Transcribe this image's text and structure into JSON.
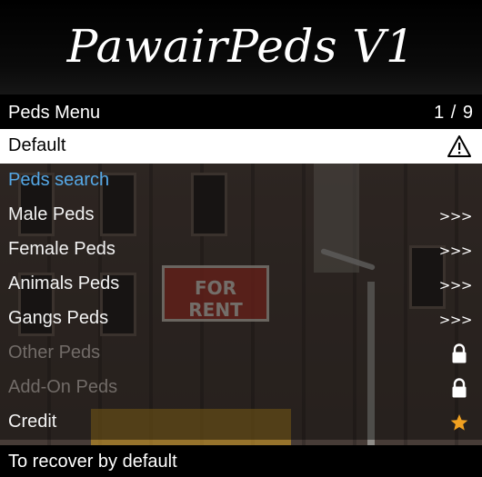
{
  "menu": {
    "title": "PawairPeds V1",
    "subtitle": "Peds Menu",
    "counter": "1 / 9",
    "items": [
      {
        "label": "Default",
        "state": "selected",
        "indicator": "warning-icon"
      },
      {
        "label": "Peds search",
        "state": "highlight",
        "indicator": ""
      },
      {
        "label": "Male Peds",
        "state": "normal",
        "indicator": ">>>"
      },
      {
        "label": "Female Peds",
        "state": "normal",
        "indicator": ">>>"
      },
      {
        "label": "Animals Peds",
        "state": "normal",
        "indicator": ">>>"
      },
      {
        "label": "Gangs Peds",
        "state": "normal",
        "indicator": ">>>"
      },
      {
        "label": "Other Peds",
        "state": "disabled",
        "indicator": "lock-icon"
      },
      {
        "label": "Add-On Peds",
        "state": "disabled",
        "indicator": "lock-icon"
      },
      {
        "label": "Credit",
        "state": "normal",
        "indicator": "star-icon"
      }
    ],
    "footer": "To recover by default"
  },
  "background": {
    "sign_text": "FOR RENT"
  },
  "colors": {
    "highlight_text": "#55a8e6",
    "selected_bg": "#ffffff",
    "star": "#f0a020"
  }
}
